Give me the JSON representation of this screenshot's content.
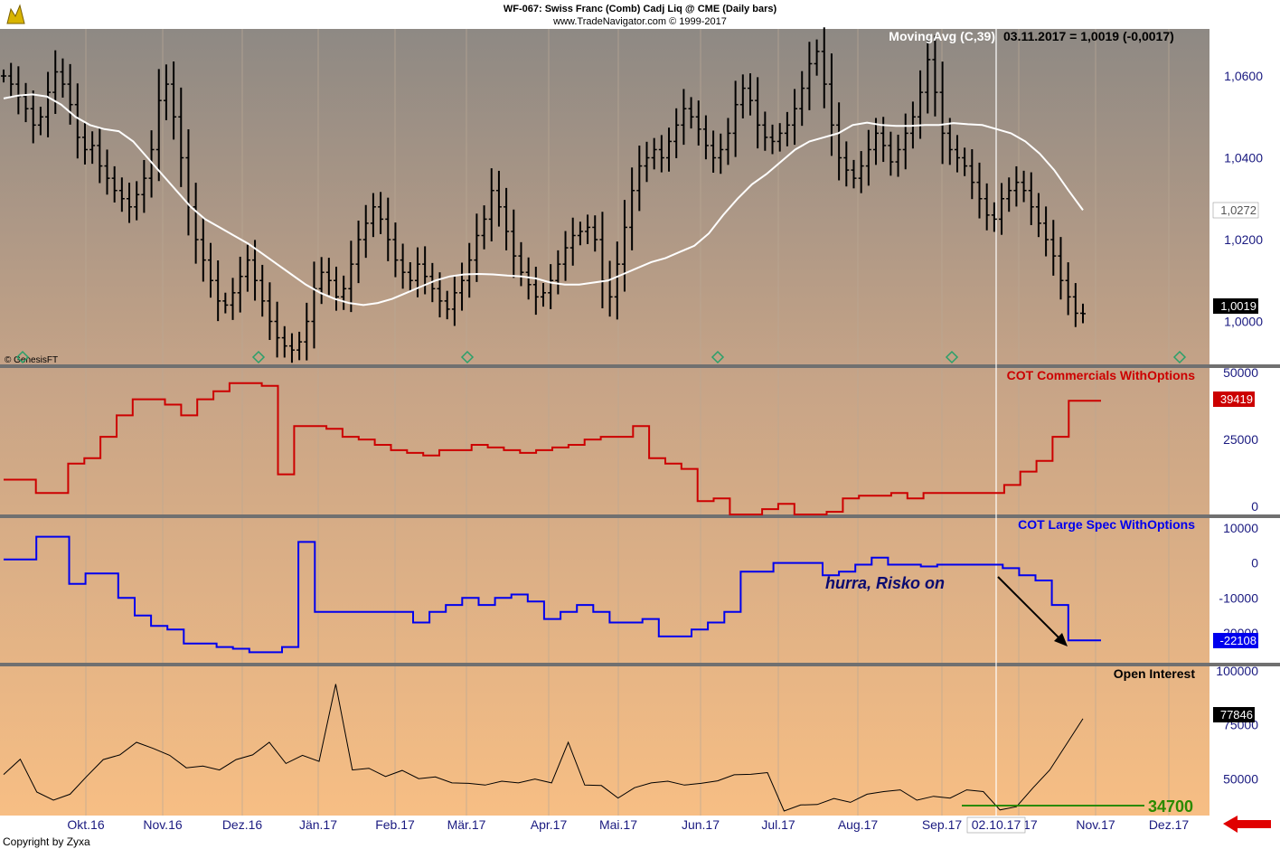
{
  "header": {
    "line1": "WF-067:  Swiss Franc (Comb) Cadj Liq @ CME  (Daily bars)",
    "line2": "www.TradeNavigator.com © 1999-2017"
  },
  "footer": {
    "copyright": "Copyright by Zyxa"
  },
  "colors": {
    "price_bg_top": "#8e8984",
    "osc_bg_bottom": "#f7be84",
    "commercials": "#cc0000",
    "large_spec": "#0000ee",
    "moving_avg": "#ffffff",
    "open_interest": "#000000",
    "axis_text": "#1a1a80",
    "support_line": "#2a8a00",
    "nav_arrow": "#e00000"
  },
  "chart_data": [
    {
      "type": "bar",
      "name": "price",
      "title": "MovingAvg (C,39)",
      "readout": "03.11.2017 = 1,0019 (-0,0017)",
      "watermark": "© GenesisFT",
      "yticks": [
        "1,0600",
        "1,0400",
        "1,0200",
        "1,0000"
      ],
      "ylim": [
        0.9895,
        1.0715
      ],
      "last_ma_label": "1,0272",
      "last_price_label": "1,0019",
      "closes": [
        1.06,
        1.058,
        1.055,
        1.052,
        1.048,
        1.05,
        1.056,
        1.061,
        1.058,
        1.053,
        1.045,
        1.042,
        1.043,
        1.038,
        1.035,
        1.032,
        1.03,
        1.028,
        1.031,
        1.035,
        1.042,
        1.054,
        1.058,
        1.05,
        1.04,
        1.028,
        1.02,
        1.015,
        1.01,
        1.005,
        1.004,
        1.007,
        1.011,
        1.015,
        1.01,
        1.005,
        1.0,
        0.996,
        0.994,
        0.993,
        0.995,
        1.0,
        1.008,
        1.012,
        1.01,
        1.006,
        1.008,
        1.014,
        1.02,
        1.024,
        1.028,
        1.025,
        1.02,
        1.015,
        1.012,
        1.01,
        1.014,
        1.011,
        1.008,
        1.005,
        1.003,
        1.007,
        1.01,
        1.015,
        1.021,
        1.025,
        1.032,
        1.028,
        1.022,
        1.016,
        1.012,
        1.009,
        1.006,
        1.007,
        1.01,
        1.014,
        1.018,
        1.021,
        1.022,
        1.023,
        1.02,
        1.01,
        1.006,
        1.014,
        1.023,
        1.032,
        1.038,
        1.04,
        1.042,
        1.04,
        1.044,
        1.048,
        1.052,
        1.05,
        1.047,
        1.043,
        1.04,
        1.042,
        1.046,
        1.053,
        1.057,
        1.054,
        1.048,
        1.045,
        1.044,
        1.046,
        1.048,
        1.052,
        1.057,
        1.063,
        1.066,
        1.058,
        1.048,
        1.04,
        1.037,
        1.035,
        1.038,
        1.042,
        1.046,
        1.043,
        1.039,
        1.042,
        1.046,
        1.05,
        1.056,
        1.064,
        1.056,
        1.046,
        1.042,
        1.04,
        1.038,
        1.034,
        1.03,
        1.026,
        1.025,
        1.03,
        1.032,
        1.034,
        1.032,
        1.028,
        1.024,
        1.02,
        1.016,
        1.01,
        1.006,
        1.002,
        1.0019
      ],
      "moving_avg": [
        1.0545,
        1.0552,
        1.0555,
        1.055,
        1.053,
        1.05,
        1.048,
        1.047,
        1.0465,
        1.044,
        1.04,
        1.036,
        1.032,
        1.028,
        1.025,
        1.023,
        1.021,
        1.019,
        1.0165,
        1.014,
        1.0115,
        1.009,
        1.007,
        1.0055,
        1.0045,
        1.004,
        1.0045,
        1.0055,
        1.007,
        1.0085,
        1.01,
        1.011,
        1.0115,
        1.0116,
        1.0115,
        1.0112,
        1.011,
        1.0105,
        1.0095,
        1.009,
        1.009,
        1.0095,
        1.01,
        1.0115,
        1.013,
        1.0145,
        1.0155,
        1.017,
        1.0185,
        1.0215,
        1.026,
        1.03,
        1.0335,
        1.036,
        1.039,
        1.042,
        1.044,
        1.045,
        1.046,
        1.048,
        1.0486,
        1.048,
        1.0478,
        1.0478,
        1.048,
        1.048,
        1.0485,
        1.0482,
        1.048,
        1.047,
        1.046,
        1.044,
        1.041,
        1.037,
        1.032,
        1.0272
      ]
    },
    {
      "type": "line",
      "name": "COT Commercials WithOptions",
      "title": "COT Commercials WithOptions",
      "yticks": [
        "50000",
        "25000",
        "0"
      ],
      "ylim": [
        -3000,
        50000
      ],
      "last_label": "39419",
      "values": [
        10000,
        10000,
        5000,
        5000,
        16000,
        18000,
        26000,
        34000,
        40000,
        40000,
        38000,
        34000,
        40000,
        43000,
        46000,
        46000,
        45000,
        12000,
        30000,
        30000,
        29000,
        26000,
        25000,
        23000,
        21000,
        20000,
        19000,
        21000,
        21000,
        23000,
        22000,
        21000,
        20000,
        21000,
        22000,
        23000,
        25000,
        26000,
        26000,
        30000,
        18000,
        16000,
        14000,
        2000,
        3000,
        -3000,
        -3000,
        -1000,
        1000,
        -3000,
        -3000,
        -2000,
        3000,
        4000,
        4000,
        5000,
        3000,
        5000,
        5000,
        5000,
        5000,
        5000,
        8000,
        13000,
        17000,
        26000,
        39419,
        39419,
        39419
      ]
    },
    {
      "type": "line",
      "name": "COT Large Spec WithOptions",
      "title": "COT Large Spec WithOptions",
      "yticks": [
        "10000",
        "0",
        "-10000",
        "-20000"
      ],
      "ylim": [
        -28500,
        11000
      ],
      "last_label": "-22108",
      "annotation": "hurra, Risko on",
      "values": [
        1000,
        1000,
        7500,
        7500,
        -6000,
        -3000,
        -3000,
        -10000,
        -15000,
        -18000,
        -19000,
        -23000,
        -23000,
        -24000,
        -24500,
        -25500,
        -25500,
        -24000,
        6000,
        -14000,
        -14000,
        -14000,
        -14000,
        -14000,
        -14000,
        -17000,
        -14000,
        -12000,
        -10000,
        -12000,
        -10000,
        -9000,
        -11000,
        -16000,
        -14000,
        -12000,
        -14000,
        -17000,
        -17000,
        -16000,
        -21000,
        -21000,
        -19000,
        -17000,
        -14000,
        -2500,
        -2500,
        0,
        0,
        0,
        -3500,
        -2500,
        -500,
        1500,
        -500,
        -500,
        -1000,
        -500,
        -500,
        -500,
        -500,
        -1500,
        -3500,
        -5000,
        -12000,
        -22108,
        -22108,
        -22108
      ]
    },
    {
      "type": "line",
      "name": "Open Interest",
      "title": "Open Interest",
      "yticks": [
        "100000",
        "75000",
        "50000"
      ],
      "ylim": [
        33000,
        100000
      ],
      "last_label": "77846",
      "support_label": "34700",
      "values": [
        52000,
        60000,
        43000,
        41000,
        42000,
        52000,
        58000,
        62000,
        66000,
        65000,
        60000,
        56000,
        55000,
        55000,
        58000,
        62000,
        66000,
        58000,
        60000,
        59000,
        93000,
        55000,
        54000,
        52000,
        53000,
        51000,
        50000,
        49000,
        47000,
        48000,
        48000,
        49000,
        49000,
        49000,
        66000,
        48000,
        46000,
        42000,
        45000,
        49000,
        48000,
        48000,
        47000,
        50000,
        51000,
        53000,
        52000,
        36000,
        37000,
        39000,
        40000,
        40000,
        42000,
        45000,
        44000,
        41000,
        41000,
        42000,
        44000,
        45000,
        34700,
        38000,
        45000,
        55000,
        65000,
        77846
      ]
    }
  ],
  "xaxis": {
    "labels": [
      "Okt.16",
      "Nov.16",
      "Dez.16",
      "Jän.17",
      "Feb.17",
      "Mär.17",
      "Apr.17",
      "Mai.17",
      "Jun.17",
      "Jul.17",
      "Aug.17",
      "Sep.17",
      "Okt.17",
      "Nov.17",
      "Dez.17"
    ],
    "cursor_date": "02.10.17"
  }
}
